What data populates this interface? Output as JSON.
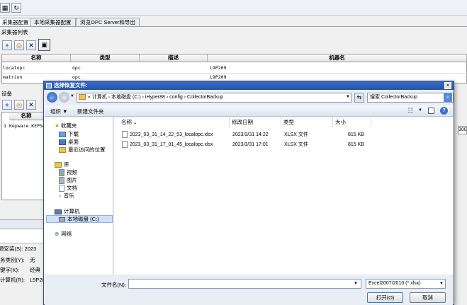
{
  "tabs": [
    "采集器配置",
    "本地采集器配置",
    "浏览OPC Server和导出"
  ],
  "collector_list": {
    "label": "采集器列表",
    "columns": [
      "名称",
      "类型",
      "描述",
      "机器名"
    ],
    "rows": [
      {
        "name": "localopc",
        "type": "opc",
        "desc": "",
        "machine": "L9P209"
      },
      {
        "name": "matrion",
        "type": "opc",
        "desc": "",
        "machine": "L9P209"
      }
    ]
  },
  "device": {
    "label": "设备",
    "column": "名称",
    "row_num": "1",
    "row_value": "Kepware.KEPSe"
  },
  "left_partial_labels": [
    "务类别(Y):",
    "键字(K):",
    "计算机(R):"
  ],
  "left_partial_values": [
    "无",
    "经典",
    "L9P20"
  ],
  "left_partial_top": "源安装(S): 2023",
  "right_partial": "300",
  "dialog": {
    "title": "选择恢复文件:",
    "breadcrumb": "« 计算机 › 本地磁盘 (C:) › iHyper88 › config › CollectorBackup",
    "search_placeholder": "搜索 CollectorBackup",
    "organize": "组织 ▼",
    "new_folder": "新建文件夹",
    "nav": {
      "favorites": "收藏夹",
      "fav_items": [
        "下载",
        "桌面",
        "最近访问的位置"
      ],
      "library": "库",
      "lib_items": [
        "视频",
        "图片",
        "文档",
        "音乐"
      ],
      "computer": "计算机",
      "disk": "本地磁盘 (C:)",
      "network": "网络"
    },
    "columns": [
      "名称",
      "修改日期",
      "类型",
      "大小"
    ],
    "files": [
      {
        "name": "2023_03_31_14_22_53_localopc.xlsx",
        "date": "2023/3/31 14:22",
        "type": "XLSX 文件",
        "size": "815 KB"
      },
      {
        "name": "2023_03_31_17_01_45_localopc.xlsx",
        "date": "2023/3/31 17:01",
        "type": "XLSX 文件",
        "size": "815 KB"
      }
    ],
    "filename_label": "文件名(N):",
    "filename_value": "",
    "filter": "Excel2007/2010 (*.xlsx)",
    "open": "打开(O)",
    "cancel": "取消"
  }
}
